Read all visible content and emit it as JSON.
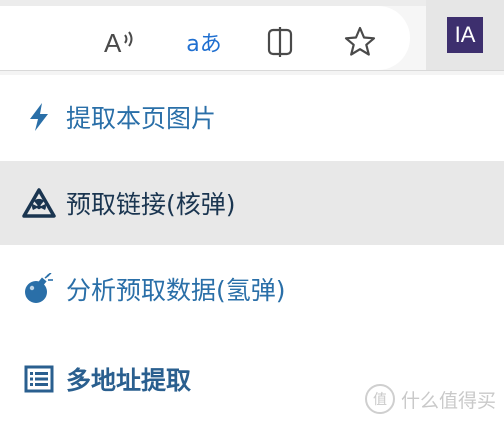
{
  "toolbar": {
    "read_aloud_icon": "read-aloud-icon",
    "translate_label": "aあ",
    "split_screen_icon": "split-screen-icon",
    "favorites_icon": "star-icon",
    "extension_badge": "IA",
    "extension_color": "#3d2f6e"
  },
  "menu": {
    "items": [
      {
        "label": "提取本页图片",
        "icon": "lightning-icon"
      },
      {
        "label": "预取链接(核弹)",
        "icon": "nuclear-warning-icon"
      },
      {
        "label": "分析预取数据(氢弹)",
        "icon": "bomb-icon"
      },
      {
        "label": "多地址提取",
        "icon": "list-icon"
      }
    ],
    "accent": "#2a6fa8"
  },
  "watermark": {
    "badge": "值",
    "text": "什么值得买"
  }
}
